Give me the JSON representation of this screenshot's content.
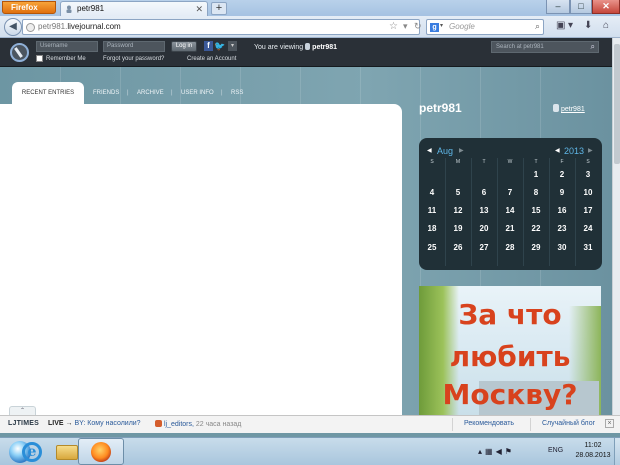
{
  "browser": {
    "menu_label": "Firefox",
    "tab_title": "petr981",
    "new_tab_label": "+",
    "url_host_prefix": "petr981.",
    "url_host_domain": "livejournal.com",
    "search_engine": "Google",
    "window_controls": {
      "minimize": "–",
      "maximize": "□",
      "close": "✕"
    }
  },
  "lj_header": {
    "username_placeholder": "Username",
    "password_placeholder": "Password",
    "login_label": "Log in",
    "remember_me": "Remember Me",
    "forgot_password": "Forgot your password?",
    "create_account": "Create an Account",
    "viewing_prefix": "You are viewing",
    "viewing_user": "petr981",
    "search_placeholder": "Search at petr981"
  },
  "journal_tabs": {
    "active": "RECENT ENTRIES",
    "items": [
      "FRIENDS",
      "ARCHIVE",
      "USER INFO",
      "RSS"
    ]
  },
  "sidebar": {
    "title": "petr981",
    "user_link": "petr981"
  },
  "calendar": {
    "month": "Aug",
    "year": "2013",
    "weekdays": [
      "S",
      "M",
      "T",
      "W",
      "T",
      "F",
      "S"
    ],
    "weeks": [
      [
        "",
        "",
        "",
        "",
        "1",
        "2",
        "3"
      ],
      [
        "4",
        "5",
        "6",
        "7",
        "8",
        "9",
        "10"
      ],
      [
        "11",
        "12",
        "13",
        "14",
        "15",
        "16",
        "17"
      ],
      [
        "18",
        "19",
        "20",
        "21",
        "22",
        "23",
        "24"
      ],
      [
        "25",
        "26",
        "27",
        "28",
        "29",
        "30",
        "31"
      ]
    ]
  },
  "ad": {
    "lines": [
      "За что",
      "любить",
      "Москву?"
    ]
  },
  "ljtimes": {
    "logo": "LJTIMES",
    "live_label": "LIVE",
    "arrow": "→",
    "headline": "BY: Кому насолили?",
    "author": "lj_editors",
    "ago": "22 часа назад",
    "recommend": "Рекомендовать",
    "random_blog": "Случайный блог",
    "close": "×"
  },
  "taskbar": {
    "language": "ENG",
    "time": "11:02",
    "date": "28.08.2013"
  }
}
